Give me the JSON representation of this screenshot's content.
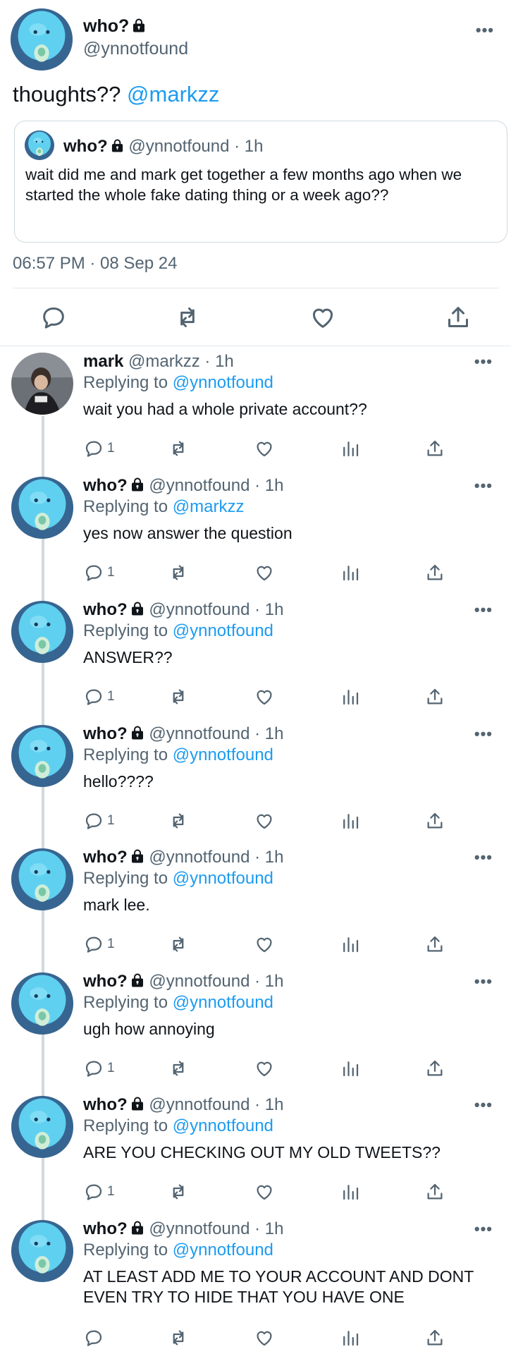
{
  "main_tweet": {
    "name": "who?",
    "handle": "@ynnotfound",
    "text_plain": "thoughts?? ",
    "text_mention": "@markzz",
    "quote": {
      "name": "who?",
      "meta": "@ynnotfound · 1h",
      "text": "wait did me and mark get together a few months ago when we started the whole fake dating thing or a week ago??"
    },
    "timestamp": "06:57 PM · 08 Sep 24",
    "actions": [
      "reply-icon",
      "retweet-icon",
      "like-icon",
      "share-icon"
    ]
  },
  "replies": [
    {
      "name": "mark",
      "meta": "@markzz · 1h",
      "reply_label": "Replying to ",
      "reply_to": "@ynnotfound",
      "text": "wait you had a whole private account??",
      "reply_count": "1",
      "avatar": "photo",
      "locked": false
    },
    {
      "name": "who?",
      "meta": "@ynnotfound · 1h",
      "reply_label": "Replying to ",
      "reply_to": "@markzz",
      "text": "yes now answer the question",
      "reply_count": "1",
      "avatar": "blue",
      "locked": true
    },
    {
      "name": "who?",
      "meta": "@ynnotfound · 1h",
      "reply_label": "Replying to ",
      "reply_to": "@ynnotfound",
      "text": "ANSWER??",
      "reply_count": "1",
      "avatar": "blue",
      "locked": true
    },
    {
      "name": "who?",
      "meta": "@ynnotfound · 1h",
      "reply_label": "Replying to ",
      "reply_to": "@ynnotfound",
      "text": "hello????",
      "reply_count": "1",
      "avatar": "blue",
      "locked": true
    },
    {
      "name": "who?",
      "meta": "@ynnotfound · 1h",
      "reply_label": "Replying to ",
      "reply_to": "@ynnotfound",
      "text": "mark lee.",
      "reply_count": "1",
      "avatar": "blue",
      "locked": true
    },
    {
      "name": "who?",
      "meta": "@ynnotfound · 1h",
      "reply_label": "Replying to ",
      "reply_to": "@ynnotfound",
      "text": "ugh how annoying",
      "reply_count": "1",
      "avatar": "blue",
      "locked": true
    },
    {
      "name": "who?",
      "meta": "@ynnotfound · 1h",
      "reply_label": "Replying to ",
      "reply_to": "@ynnotfound",
      "text": "ARE YOU CHECKING OUT MY OLD TWEETS??",
      "reply_count": "1",
      "avatar": "blue",
      "locked": true
    },
    {
      "name": "who?",
      "meta": "@ynnotfound · 1h",
      "reply_label": "Replying to ",
      "reply_to": "@ynnotfound",
      "text": "AT LEAST ADD ME TO YOUR ACCOUNT AND DONT EVEN TRY TO HIDE THAT YOU HAVE ONE",
      "reply_count": "",
      "avatar": "blue",
      "locked": true
    }
  ],
  "more_label": "•••",
  "colors": {
    "link": "#1d9bf0",
    "muted": "#536471",
    "border": "#cfd9de",
    "avatar_blue": "#4fc3e6"
  }
}
